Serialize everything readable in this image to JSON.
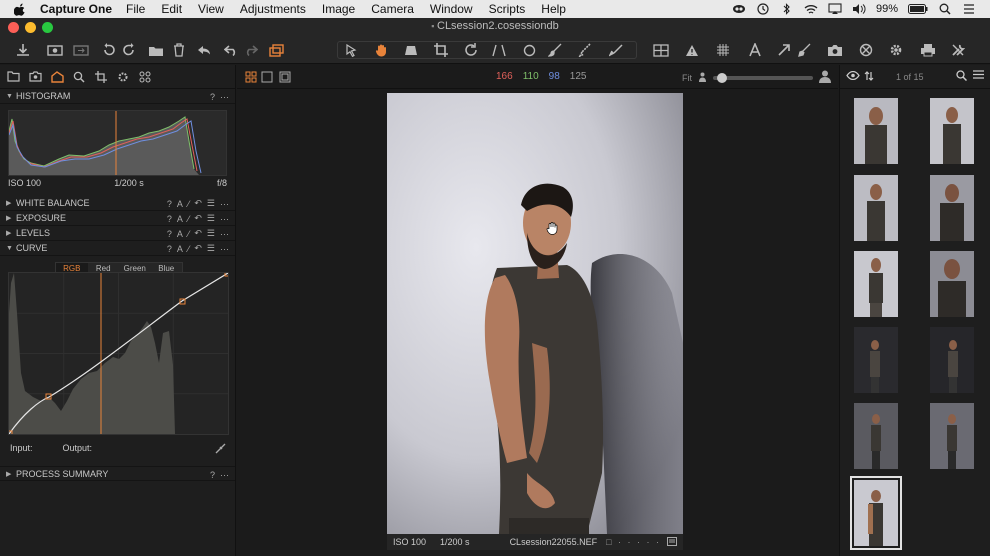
{
  "menubar": {
    "app_name": "Capture One",
    "menus": [
      "File",
      "Edit",
      "View",
      "Adjustments",
      "Image",
      "Camera",
      "Window",
      "Scripts",
      "Help"
    ],
    "battery": "99%"
  },
  "window": {
    "title": "CLsession2.cosessiondb"
  },
  "left_panel": {
    "histogram": {
      "label": "HISTOGRAM",
      "iso": "ISO 100",
      "shutter": "1/200 s",
      "aperture": "f/8"
    },
    "sections": [
      "WHITE BALANCE",
      "EXPOSURE",
      "LEVELS"
    ],
    "curve": {
      "label": "CURVE",
      "tabs": [
        "RGB",
        "Red",
        "Green",
        "Blue"
      ],
      "input_label": "Input:",
      "output_label": "Output:"
    },
    "process_summary": "PROCESS SUMMARY",
    "help_glyph": "?"
  },
  "viewer": {
    "rgb": {
      "r": "166",
      "g": "110",
      "b": "98",
      "l": "125"
    },
    "fit_label": "Fit",
    "status": {
      "iso": "ISO 100",
      "shutter": "1/200 s",
      "filename": "CLsession22055.NEF"
    }
  },
  "browser": {
    "count": "1 of 15"
  },
  "colors": {
    "accent": "#e8833a",
    "red": "#e0605a",
    "green": "#7fc06a",
    "blue": "#6f8fe0"
  }
}
